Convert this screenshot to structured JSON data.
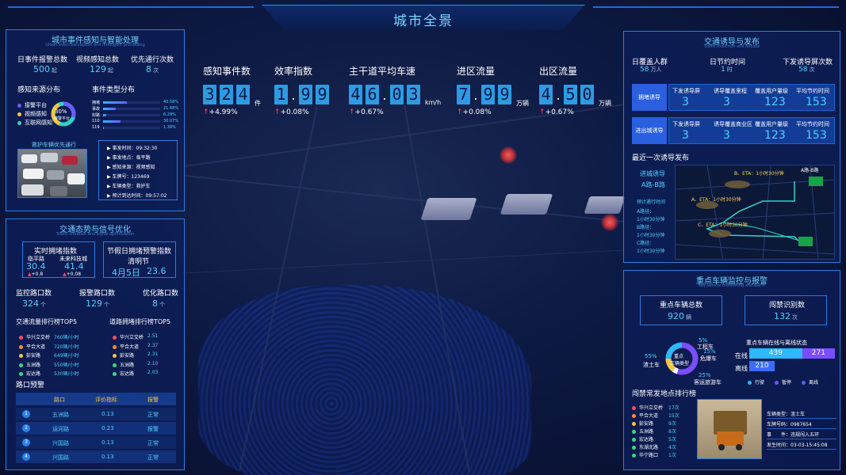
{
  "header": {
    "title": "城市全景"
  },
  "event_panel": {
    "title": "城市事件感知与智能处理",
    "subtitle": "Urban event perception and intelligent processing",
    "stats": [
      {
        "label": "日事件报警总数",
        "value": "500",
        "unit": "起"
      },
      {
        "label": "视频感知总数",
        "value": "129",
        "unit": "起"
      },
      {
        "label": "优先通行次数",
        "value": "8",
        "unit": "次"
      }
    ],
    "source_title": "感知来源分布",
    "sources": [
      {
        "label": "接警平台",
        "color": "#6a5cff"
      },
      {
        "label": "视频感知",
        "color": "#f5c542"
      },
      {
        "label": "互联网感知",
        "color": "#2fd3c9"
      }
    ],
    "donut": {
      "pct": "30%",
      "label": "接警平台",
      "fraction": 0.3
    },
    "type_title": "事件类型分布",
    "types": [
      {
        "label": "拥堵",
        "pct": "40.58%",
        "fraction": 0.41
      },
      {
        "label": "事故",
        "pct": "21.68%",
        "fraction": 0.22
      },
      {
        "label": "封路",
        "pct": "6.29%",
        "fraction": 0.06
      },
      {
        "label": "110",
        "pct": "30.07%",
        "fraction": 0.3
      },
      {
        "label": "119",
        "pct": "1.38%",
        "fraction": 0.02
      }
    ],
    "video_title": "救护车辆优先通行",
    "details": [
      {
        "label": "事发时间",
        "value": "09:32:30"
      },
      {
        "label": "事发地点",
        "value": "临平路"
      },
      {
        "label": "感知来源",
        "value": "视频感知"
      },
      {
        "label": "车牌号",
        "value": "123469"
      },
      {
        "label": "车辆类型",
        "value": "救护车"
      },
      {
        "label": "预计到达时间",
        "value": "09:57:02"
      }
    ]
  },
  "traffic_panel": {
    "title": "交通态势与信号优化",
    "subtitle": "Traffic situation and signal optimization",
    "realtime_title": "实时拥堵指数",
    "realtime": [
      {
        "name": "临平路",
        "value": "30.4",
        "delta": "+0.8"
      },
      {
        "name": "未来科技城",
        "value": "41.4",
        "delta": "+0.08"
      }
    ],
    "holiday_title": "节假日拥堵预警指数",
    "holiday_name": "清明节",
    "holiday_date": "4月5日",
    "holiday_value": "23.6",
    "stats": [
      {
        "label": "监控路口数",
        "value": "324",
        "unit": "个"
      },
      {
        "label": "报警路口数",
        "value": "129",
        "unit": "个"
      },
      {
        "label": "优化路口数",
        "value": "8",
        "unit": "个"
      }
    ],
    "flow_title": "交通流量排行榜TOP5",
    "flow": [
      {
        "name": "华兴立交桥",
        "value": "760辆/小时",
        "color": "#ff4d6a"
      },
      {
        "name": "平合大道",
        "value": "720辆/小时",
        "color": "#ff8c3a"
      },
      {
        "name": "彭安路",
        "value": "649辆/小时",
        "color": "#f5c542"
      },
      {
        "name": "五洲路",
        "value": "550辆/小时",
        "color": "#3ad97e"
      },
      {
        "name": "宏达路",
        "value": "530辆/小时",
        "color": "#3ad97e"
      }
    ],
    "jam_title": "道路拥堵排行榜TOP5",
    "jam": [
      {
        "name": "华兴立交桥",
        "value": "2.51",
        "color": "#ff4d6a"
      },
      {
        "name": "平合大道",
        "value": "2.37",
        "color": "#ff8c3a"
      },
      {
        "name": "彭安路",
        "value": "2.31",
        "color": "#f5c542"
      },
      {
        "name": "五洲路",
        "value": "2.10",
        "color": "#3ad97e"
      },
      {
        "name": "宏达路",
        "value": "2.03",
        "color": "#3ad97e"
      }
    ],
    "warn_title": "路口预警",
    "warn_headers": [
      "路口",
      "评价指标",
      "报警"
    ],
    "warn_rows": [
      {
        "no": "1",
        "road": "五洲路",
        "index": "0.13",
        "status": "正常"
      },
      {
        "no": "2",
        "road": "运河路",
        "index": "0.23",
        "status": "报警"
      },
      {
        "no": "3",
        "road": "兴国路",
        "index": "0.13",
        "status": "正常"
      },
      {
        "no": "4",
        "road": "兴国路",
        "index": "0.13",
        "status": "正常"
      }
    ]
  },
  "kpis": [
    {
      "label": "感知事件数",
      "digits": [
        "3",
        "2",
        "4"
      ],
      "unit": "件",
      "delta": "+4.99%"
    },
    {
      "label": "效率指数",
      "digits": [
        "1",
        ".",
        "9",
        "9"
      ],
      "unit": "",
      "delta": "+0.08%"
    },
    {
      "label": "主干道平均车速",
      "digits": [
        "4",
        "6",
        ".",
        "0",
        "3"
      ],
      "unit": "km/h",
      "delta": "+0.67%"
    },
    {
      "label": "进区流量",
      "digits": [
        "7",
        ".",
        "9",
        "9"
      ],
      "unit": "万辆",
      "delta": "+0.08%"
    },
    {
      "label": "出区流量",
      "digits": [
        "4",
        ".",
        "5",
        "0"
      ],
      "unit": "万辆",
      "delta": "+0.67%"
    }
  ],
  "guide_panel": {
    "title": "交通诱导与发布",
    "subtitle": "Traffic induction and release",
    "stats": [
      {
        "label": "日覆盖人群",
        "value": "58",
        "unit": "万人"
      },
      {
        "label": "日节约时间",
        "value": "1",
        "unit": "时"
      },
      {
        "label": "下发诱导屏次数",
        "value": "58",
        "unit": "次"
      }
    ],
    "cols": [
      "下发诱导屏",
      "诱导覆盖里程",
      "覆盖用户量级",
      "平均节约时间"
    ],
    "rows": [
      {
        "name": "拥堵诱导",
        "values": [
          "3",
          "3",
          "123",
          "153"
        ]
      },
      {
        "name": "进出城诱导",
        "values": [
          "3",
          "3",
          "123",
          "153"
        ],
        "cols": [
          "下发诱导屏",
          "诱导覆盖商业区",
          "覆盖用户量级",
          "平均节约时间"
        ]
      }
    ],
    "latest_title": "最近一次诱导发布",
    "latest": {
      "title": "进城诱导",
      "route": "A路-B路",
      "eta_title": "预计通行时间",
      "lines": [
        "A路径：",
        "1小时30分钟",
        "B路径：",
        "1小时30分钟",
        "C路径：",
        "1小时30分钟"
      ],
      "map_labels": [
        "A路-B路",
        "B、ETA：1小时30分钟",
        "A、ETA：1小时30分钟",
        "C、ETA：1小时30分钟"
      ]
    }
  },
  "vehicle_panel": {
    "title": "重点车辆监控与报警",
    "subtitle": "Key vehicle monitoring and alarm",
    "total_label": "重点车辆总数",
    "total_value": "920",
    "total_unit": "辆",
    "forbid_label": "闯禁识别数",
    "forbid_value": "132",
    "forbid_unit": "次",
    "donut_center": [
      "重点",
      "车辆类型"
    ],
    "donut": [
      {
        "label": "渣土车",
        "pct": "55%",
        "value": 55,
        "color": "#7b4dff"
      },
      {
        "label": "工程车",
        "pct": "5%",
        "value": 5,
        "color": "#ffffff"
      },
      {
        "label": "危爆车",
        "pct": "15%",
        "value": 15,
        "color": "#f5c542"
      },
      {
        "label": "客运旅游车",
        "pct": "25%",
        "value": 25,
        "color": "#2fb7ff"
      }
    ],
    "status_title": "重点车辆在线与离线状态",
    "online_label": "在线",
    "online_values": [
      "439",
      "271"
    ],
    "offline_label": "离线",
    "offline_value": "210",
    "status_legend": [
      {
        "label": "行驶",
        "color": "#2fb7ff"
      },
      {
        "label": "暂停",
        "color": "#7b4dff"
      },
      {
        "label": "离线",
        "color": "#3b6cff"
      }
    ],
    "rank_title": "闯禁常发地点排行榜",
    "rank": [
      {
        "name": "华兴立交桥",
        "value": "17次",
        "color": "#ff4d6a"
      },
      {
        "name": "平合大道",
        "value": "15次",
        "color": "#ff8c3a"
      },
      {
        "name": "彭安路",
        "value": "9次",
        "color": "#f5c542"
      },
      {
        "name": "五洲路",
        "value": "8次",
        "color": "#3ad97e"
      },
      {
        "name": "宏达路",
        "value": "5次",
        "color": "#3ad97e"
      },
      {
        "name": "东湖北路",
        "value": "4次",
        "color": "#3ad97e"
      },
      {
        "name": "华宁路口",
        "value": "1次",
        "color": "#3ad97e"
      }
    ],
    "record": [
      {
        "label": "车辆类型：",
        "value": "渣土车"
      },
      {
        "label": "车牌号码：",
        "value": "0987654"
      },
      {
        "label": "事　　件：",
        "value": "违规闯入五环"
      },
      {
        "label": "发生时间：",
        "value": "03-03-15:45:08"
      }
    ]
  }
}
